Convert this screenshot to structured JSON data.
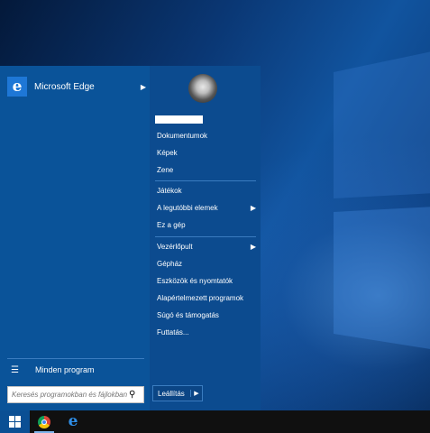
{
  "start_menu": {
    "pinned": [
      {
        "label": "Microsoft Edge",
        "icon": "edge-icon",
        "has_submenu": true
      }
    ],
    "all_programs_label": "Minden program",
    "search_placeholder": "Keresés programokban és fájlokban",
    "user": {
      "avatar": "user-avatar"
    },
    "right_groups": [
      [
        {
          "label": "Dokumentumok",
          "has_submenu": false
        },
        {
          "label": "Képek",
          "has_submenu": false
        },
        {
          "label": "Zene",
          "has_submenu": false
        }
      ],
      [
        {
          "label": "Játékok",
          "has_submenu": false
        },
        {
          "label": "A legutóbbi elemek",
          "has_submenu": true
        },
        {
          "label": "Ez a gép",
          "has_submenu": false
        }
      ],
      [
        {
          "label": "Vezérlőpult",
          "has_submenu": true
        },
        {
          "label": "Gépház",
          "has_submenu": false
        },
        {
          "label": "Eszközök és nyomtatók",
          "has_submenu": false
        },
        {
          "label": "Alapértelmezett programok",
          "has_submenu": false
        },
        {
          "label": "Súgó és támogatás",
          "has_submenu": false
        },
        {
          "label": "Futtatás...",
          "has_submenu": false
        }
      ]
    ],
    "shutdown_label": "Leállítás"
  },
  "taskbar": {
    "items": [
      {
        "name": "chrome",
        "icon": "chrome-icon",
        "active": true
      },
      {
        "name": "edge",
        "icon": "edge-icon",
        "active": false
      }
    ]
  },
  "colors": {
    "start_menu_bg": "#0a4f94",
    "accent": "#1e77d6",
    "taskbar_bg": "#101010"
  }
}
